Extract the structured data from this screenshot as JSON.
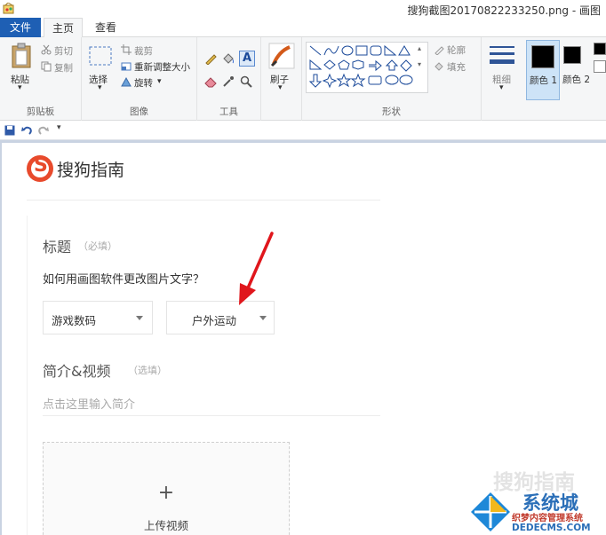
{
  "window": {
    "title": "搜狗截图20170822233250.png - 画图"
  },
  "tabs": [
    {
      "label": "文件"
    },
    {
      "label": "主页"
    },
    {
      "label": "查看"
    }
  ],
  "ribbon": {
    "clipboard": {
      "paste": "粘贴",
      "cut": "剪切",
      "copy": "复制",
      "group": "剪贴板"
    },
    "image": {
      "select": "选择",
      "crop": "裁剪",
      "resize": "重新调整大小",
      "rotate": "旋转",
      "group": "图像"
    },
    "tools": {
      "group": "工具"
    },
    "brush": {
      "label": "刷子"
    },
    "shapes": {
      "outline": "轮廓",
      "fill": "填充",
      "group": "形状"
    },
    "size": {
      "label": "粗细"
    },
    "colors": {
      "color1": "颜色 1",
      "color2": "颜色 2"
    }
  },
  "page": {
    "logo_text": "搜狗指南",
    "title_label": "标题",
    "title_hint": "（必填）",
    "question": "如何用画图软件更改图片文字？",
    "select1": "游戏数码",
    "select2": "户外运动",
    "intro_label": "简介&视频",
    "intro_hint": "（选填）",
    "intro_placeholder": "点击这里输入简介",
    "upload_plus": "+",
    "upload_label": "上传视频"
  },
  "watermarks": {
    "sogou": "搜狗指南",
    "site_name": "系统城",
    "site_cn": "织梦内容管理系统",
    "site_url": "DEDECMS.COM"
  },
  "colors": {
    "file_tab": "#1e5fb4",
    "arrow": "#e0161c",
    "logo": "#e84a2c"
  }
}
